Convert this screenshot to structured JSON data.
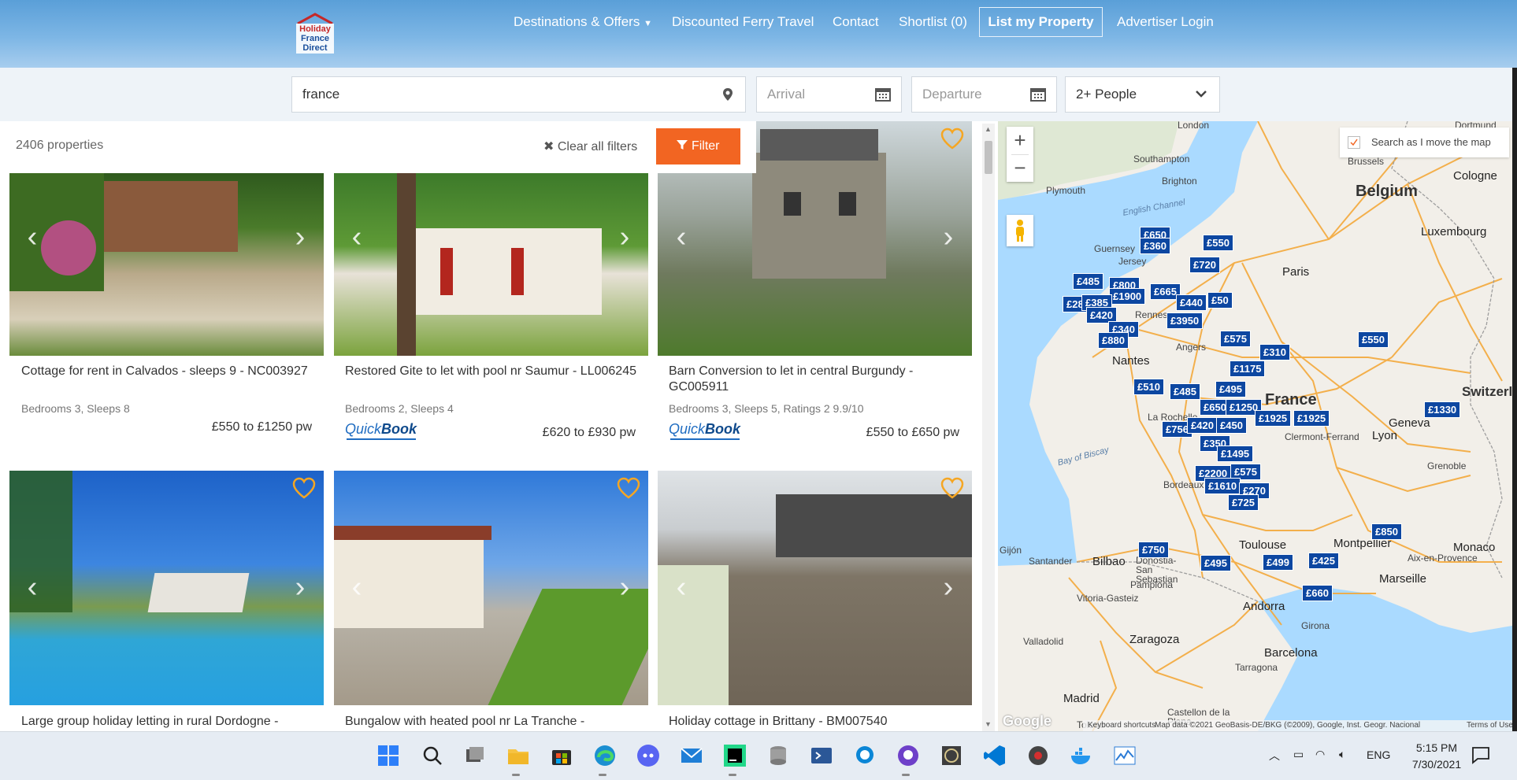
{
  "header": {
    "logo_text": [
      "Holiday",
      "France",
      "Direct"
    ],
    "nav": [
      "Destinations & Offers",
      "Discounted Ferry Travel",
      "Contact",
      "Shortlist (0)"
    ],
    "list_property": "List my Property",
    "advertiser_login": "Advertiser Login"
  },
  "search": {
    "location_value": "france",
    "arrival_placeholder": "Arrival",
    "departure_placeholder": "Departure",
    "people_value": "2+ People"
  },
  "filters": {
    "count": "2406 properties",
    "clear": "Clear all filters",
    "filter_btn": "Filter"
  },
  "cards": [
    {
      "title": "Cottage for rent in Calvados - sleeps 9 - NC003927",
      "meta": "Bedrooms 3, Sleeps 8",
      "price": "£550 to £1250 pw",
      "quickbook": false
    },
    {
      "title": "Restored Gite to let with pool nr Saumur - LL006245",
      "meta": "Bedrooms 2, Sleeps 4",
      "price": "£620 to £930 pw",
      "quickbook": true
    },
    {
      "title": "Barn Conversion to let in central Burgundy - GC005911",
      "meta": "Bedrooms 3, Sleeps 5, Ratings 2 9.9/10",
      "price": "£550 to £650 pw",
      "quickbook": true
    },
    {
      "title": "Large group holiday letting in rural Dordogne -"
    },
    {
      "title": "Bungalow with heated pool nr La Tranche -"
    },
    {
      "title": "Holiday cottage in Brittany - BM007540"
    }
  ],
  "quickbook": {
    "a": "Quick",
    "b": "Book"
  },
  "map": {
    "search_as_move": "Search as I move the map",
    "zoom_in": "+",
    "zoom_out": "−",
    "footer_keyboard": "Keyboard shortcuts",
    "footer_data": "Map data ©2021 GeoBasis-DE/BKG (©2009), Google, Inst. Geogr. Nacional",
    "footer_terms": "Terms of Use",
    "google": "Google",
    "labels": [
      "London",
      "Dortmund",
      "Southampton",
      "Brighton",
      "Plymouth",
      "English Channel",
      "Belgium",
      "Brussels",
      "Cologne",
      "Luxembourg",
      "Guernsey",
      "Jersey",
      "Paris",
      "Rennes",
      "Nantes",
      "Angers",
      "France",
      "Switzerland",
      "Geneva",
      "Lyon",
      "La Rochelle",
      "Clermont-Ferrand",
      "Bay of Biscay",
      "Bordeaux",
      "Grenoble",
      "Toulouse",
      "Montpellier",
      "Monaco",
      "Aix-en-Provence",
      "Marseille",
      "Gijón",
      "Santander",
      "Bilbao",
      "Donostia-San Sebastian",
      "Pamplona",
      "Vitoria-Gasteiz",
      "Andorra",
      "Girona",
      "Zaragoza",
      "Barcelona",
      "Tarragona",
      "Valladolid",
      "Madrid",
      "Toledo",
      "Castellon de la Plana"
    ],
    "pins": [
      "£650",
      "£360",
      "£550",
      "£720",
      "£485",
      "£800",
      "£665",
      "£1900",
      "£280",
      "£385",
      "£440",
      "£50",
      "£420",
      "£340",
      "£3950",
      "£880",
      "£575",
      "£310",
      "£550",
      "£1175",
      "£510",
      "£485",
      "£495",
      "£650",
      "£1250",
      "£1925",
      "£1925",
      "£1330",
      "£756",
      "£420",
      "£450",
      "£350",
      "£1495",
      "£2200",
      "£575",
      "£1610",
      "£270",
      "£725",
      "£750",
      "£495",
      "£499",
      "£425",
      "£850",
      "£660"
    ]
  },
  "taskbar": {
    "lang": "ENG",
    "time": "5:15 PM",
    "date": "7/30/2021"
  }
}
